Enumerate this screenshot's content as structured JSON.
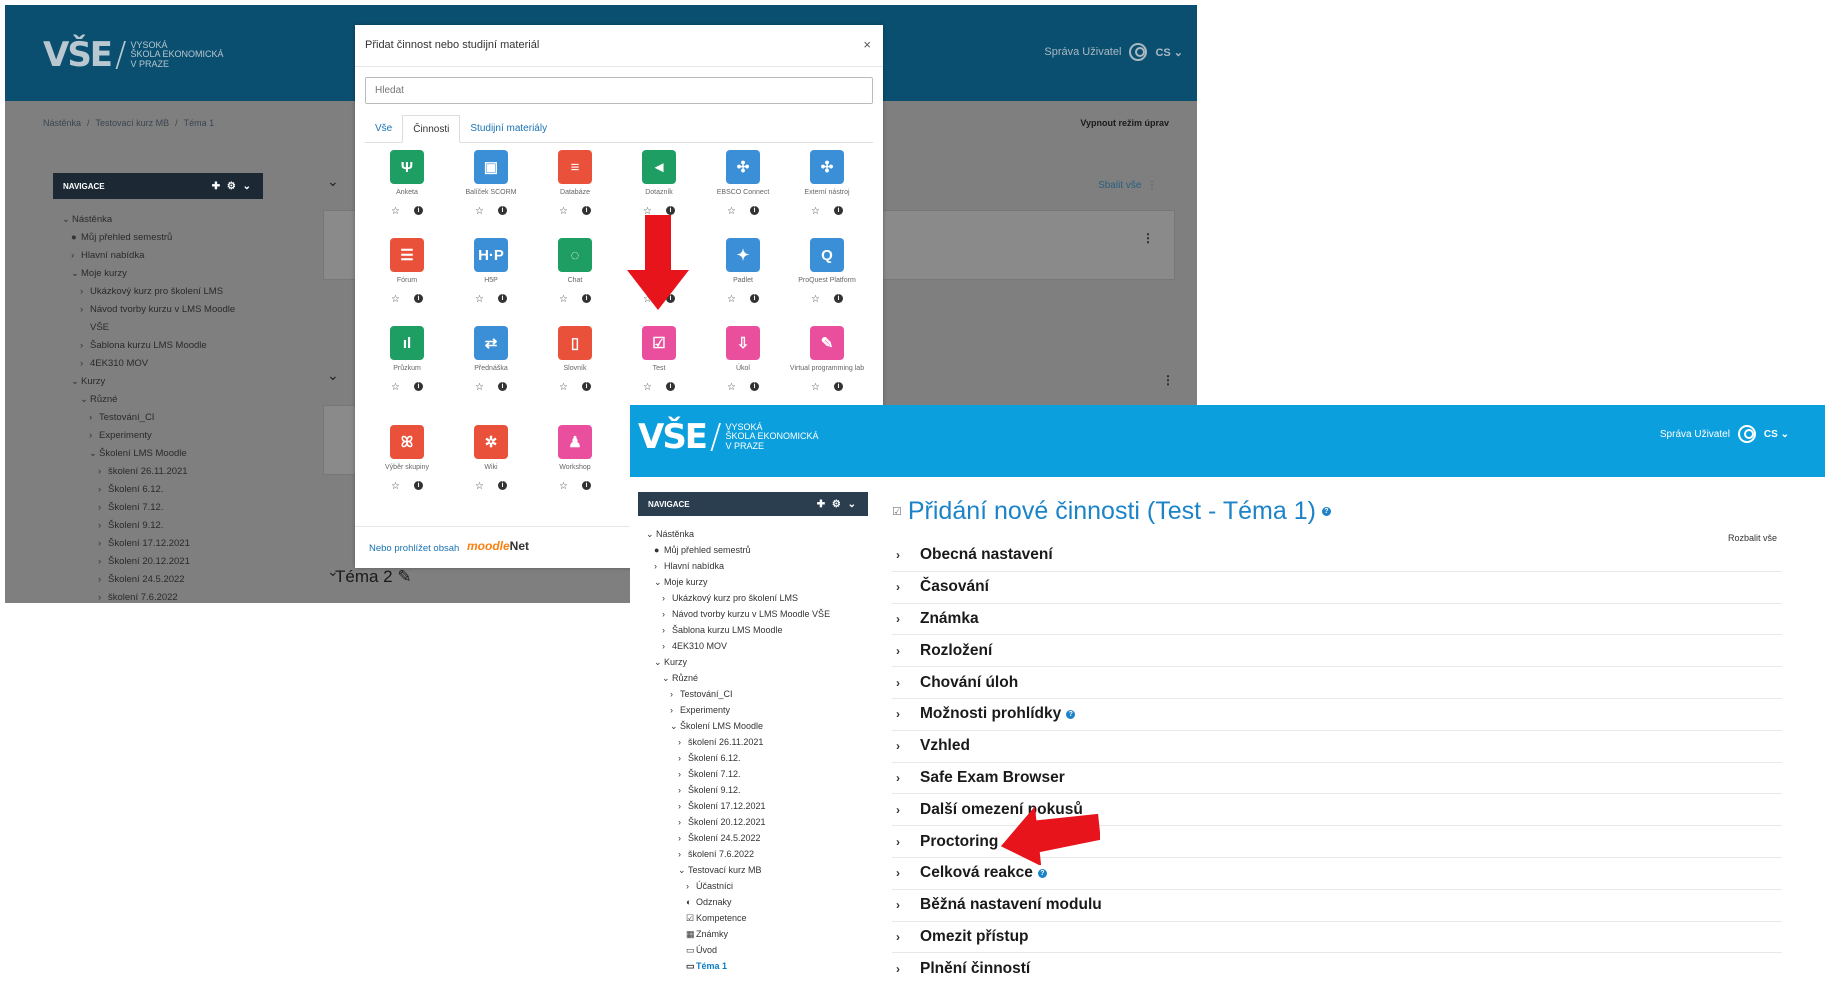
{
  "brand": {
    "logo_mark": "VŠE",
    "logo_lines": [
      "Vysoká",
      "škola ekonomická",
      "v Praze"
    ],
    "user": "Správa Uživatel",
    "lang": "CS"
  },
  "back": {
    "breadcrumb": [
      "Nástěnka",
      "Testovací kurz MB",
      "Téma 1"
    ],
    "edit_off": "Vypnout režim úprav",
    "collapse_all": "Sbalit vše",
    "section2": "Téma 2",
    "nav": {
      "title": "NAVIGACE",
      "items": [
        {
          "t": "Nástěnka",
          "i": 1,
          "c": "v"
        },
        {
          "t": "Můj přehled semestrů",
          "i": 2,
          "c": "o"
        },
        {
          "t": "Hlavní nabídka",
          "i": 2,
          "c": ">"
        },
        {
          "t": "Moje kurzy",
          "i": 2,
          "c": "v"
        },
        {
          "t": "Ukázkový kurz pro školení LMS",
          "i": 3,
          "c": ">"
        },
        {
          "t": "Návod tvorby kurzu v LMS Moodle",
          "i": 3,
          "c": ">"
        },
        {
          "t": "VŠE",
          "i": 3,
          "c": ""
        },
        {
          "t": "Šablona kurzu LMS Moodle",
          "i": 3,
          "c": ">"
        },
        {
          "t": "4EK310 MOV",
          "i": 3,
          "c": ">"
        },
        {
          "t": "Kurzy",
          "i": 2,
          "c": "v"
        },
        {
          "t": "Různé",
          "i": 3,
          "c": "v"
        },
        {
          "t": "Testování_CI",
          "i": 4,
          "c": ">"
        },
        {
          "t": "Experimenty",
          "i": 4,
          "c": ">"
        },
        {
          "t": "Školení LMS Moodle",
          "i": 4,
          "c": "v"
        },
        {
          "t": "školení 26.11.2021",
          "i": 5,
          "c": ">"
        },
        {
          "t": "Školení 6.12.",
          "i": 5,
          "c": ">"
        },
        {
          "t": "Školení 7.12.",
          "i": 5,
          "c": ">"
        },
        {
          "t": "Školení 9.12.",
          "i": 5,
          "c": ">"
        },
        {
          "t": "Školení 17.12.2021",
          "i": 5,
          "c": ">"
        },
        {
          "t": "Školení 20.12.2021",
          "i": 5,
          "c": ">"
        },
        {
          "t": "Školení 24.5.2022",
          "i": 5,
          "c": ">"
        },
        {
          "t": "školení 7.6.2022",
          "i": 5,
          "c": ">"
        }
      ]
    },
    "modal": {
      "title": "Přidat činnost nebo studijní materiál",
      "close": "×",
      "search_placeholder": "Hledat",
      "tabs": [
        "Vše",
        "Činnosti",
        "Studijní materiály"
      ],
      "activities": [
        {
          "name": "Anketa",
          "color": "#1e9e62",
          "glyph": "Ψ"
        },
        {
          "name": "Balíček SCORM",
          "color": "#3a8fd6",
          "glyph": "▣"
        },
        {
          "name": "Databáze",
          "color": "#e9513b",
          "glyph": "≡"
        },
        {
          "name": "Dotazník",
          "color": "#1e9e62",
          "glyph": "◄"
        },
        {
          "name": "EBSCO Connect",
          "color": "#3a8fd6",
          "glyph": "✣"
        },
        {
          "name": "Externí nástroj",
          "color": "#3a8fd6",
          "glyph": "✣"
        },
        {
          "name": "Fórum",
          "color": "#e9513b",
          "glyph": "☰"
        },
        {
          "name": "H5P",
          "color": "#3a8fd6",
          "glyph": "H·P"
        },
        {
          "name": "Chat",
          "color": "#1e9e62",
          "glyph": "◌"
        },
        {
          "name": "",
          "color": "#ffffff",
          "glyph": ""
        },
        {
          "name": "Padlet",
          "color": "#3a8fd6",
          "glyph": "✦"
        },
        {
          "name": "ProQuest Platform",
          "color": "#3a8fd6",
          "glyph": "Q"
        },
        {
          "name": "Průzkum",
          "color": "#1e9e62",
          "glyph": "ıl"
        },
        {
          "name": "Přednáška",
          "color": "#3a8fd6",
          "glyph": "⇄"
        },
        {
          "name": "Slovník",
          "color": "#e9513b",
          "glyph": "▯"
        },
        {
          "name": "Test",
          "color": "#ea4f9d",
          "glyph": "☑"
        },
        {
          "name": "Úkol",
          "color": "#ea4f9d",
          "glyph": "⇩"
        },
        {
          "name": "Virtual programming lab",
          "color": "#ea4f9d",
          "glyph": "✎"
        },
        {
          "name": "Výběr skupiny",
          "color": "#e9513b",
          "glyph": "ꕤ"
        },
        {
          "name": "Wiki",
          "color": "#e9513b",
          "glyph": "✲"
        },
        {
          "name": "Workshop",
          "color": "#ea4f9d",
          "glyph": "♟"
        }
      ],
      "star": "☆",
      "info": "i",
      "footer_link": "Nebo prohlížet obsah",
      "moodlenet_m": "moodle",
      "moodlenet_net": "Net"
    }
  },
  "front": {
    "page_title": "Přidání nové činnosti (Test - Téma 1)",
    "expand_all": "Rozbalit vše",
    "nav": {
      "title": "NAVIGACE",
      "items": [
        {
          "t": "Nástěnka",
          "i": 1,
          "c": "v"
        },
        {
          "t": "Můj přehled semestrů",
          "i": 2,
          "c": "o"
        },
        {
          "t": "Hlavní nabídka",
          "i": 2,
          "c": ">"
        },
        {
          "t": "Moje kurzy",
          "i": 2,
          "c": "v"
        },
        {
          "t": "Ukázkový kurz pro školení LMS",
          "i": 3,
          "c": ">"
        },
        {
          "t": "Návod tvorby kurzu v LMS Moodle VŠE",
          "i": 3,
          "c": ">"
        },
        {
          "t": "Šablona kurzu LMS Moodle",
          "i": 3,
          "c": ">"
        },
        {
          "t": "4EK310 MOV",
          "i": 3,
          "c": ">"
        },
        {
          "t": "Kurzy",
          "i": 2,
          "c": "v"
        },
        {
          "t": "Různé",
          "i": 3,
          "c": "v"
        },
        {
          "t": "Testování_CI",
          "i": 4,
          "c": ">"
        },
        {
          "t": "Experimenty",
          "i": 4,
          "c": ">"
        },
        {
          "t": "Školení LMS Moodle",
          "i": 4,
          "c": "v"
        },
        {
          "t": "školení 26.11.2021",
          "i": 5,
          "c": ">"
        },
        {
          "t": "Školení 6.12.",
          "i": 5,
          "c": ">"
        },
        {
          "t": "Školení 7.12.",
          "i": 5,
          "c": ">"
        },
        {
          "t": "Školení 9.12.",
          "i": 5,
          "c": ">"
        },
        {
          "t": "Školení 17.12.2021",
          "i": 5,
          "c": ">"
        },
        {
          "t": "Školení 20.12.2021",
          "i": 5,
          "c": ">"
        },
        {
          "t": "Školení 24.5.2022",
          "i": 5,
          "c": ">"
        },
        {
          "t": "školení 7.6.2022",
          "i": 5,
          "c": ">"
        },
        {
          "t": "Testovací kurz MB",
          "i": 5,
          "c": "v"
        },
        {
          "t": "Účastníci",
          "i": 6,
          "c": ">"
        },
        {
          "t": "Odznaky",
          "i": 6,
          "c": "◐"
        },
        {
          "t": "Kompetence",
          "i": 6,
          "c": "☑"
        },
        {
          "t": "Známky",
          "i": 6,
          "c": "▦"
        },
        {
          "t": "Úvod",
          "i": 6,
          "c": "▭"
        },
        {
          "t": "Téma 1",
          "i": 6,
          "c": "▭",
          "active": true
        }
      ]
    },
    "sections": [
      {
        "label": "Obecná nastavení"
      },
      {
        "label": "Časování"
      },
      {
        "label": "Známka"
      },
      {
        "label": "Rozložení"
      },
      {
        "label": "Chování úloh"
      },
      {
        "label": "Možnosti prohlídky",
        "help": true
      },
      {
        "label": "Vzhled"
      },
      {
        "label": "Safe Exam Browser"
      },
      {
        "label": "Další omezení pokusů"
      },
      {
        "label": "Proctoring"
      },
      {
        "label": "Celková reakce",
        "help": true
      },
      {
        "label": "Běžná nastavení modulu"
      },
      {
        "label": "Omezit přístup"
      },
      {
        "label": "Plnění činností"
      }
    ],
    "help_glyph": "?"
  },
  "colors": {
    "arrow": "#e8141c",
    "header_back": "#0b4f70",
    "header_front": "#0c9fde",
    "link": "#1c83c8"
  }
}
